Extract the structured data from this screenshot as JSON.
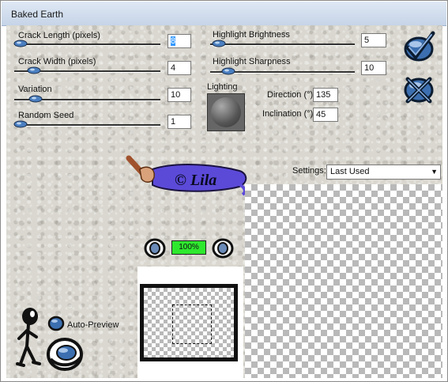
{
  "window": {
    "title": "Baked Earth"
  },
  "params": {
    "crack_length": {
      "label": "Crack Length (pixels)",
      "value": "8",
      "position": 0.0
    },
    "crack_width": {
      "label": "Crack Width (pixels)",
      "value": "4",
      "position": 0.1
    },
    "variation": {
      "label": "Variation",
      "value": "10",
      "position": 0.12
    },
    "random_seed": {
      "label": "Random Seed",
      "value": "1",
      "position": 0.0
    },
    "highlight_brightness": {
      "label": "Highlight Brightness",
      "value": "5",
      "position": 0.02
    },
    "highlight_sharpness": {
      "label": "Highlight Sharpness",
      "value": "10",
      "position": 0.05
    }
  },
  "lighting": {
    "label": "Lighting",
    "direction_label": "Direction (°)",
    "direction": "135",
    "inclination_label": "Inclination (°)",
    "inclination": "45"
  },
  "logo": {
    "text": "© Lila"
  },
  "settings": {
    "label": "Settings:",
    "value": "Last Used"
  },
  "preview": {
    "zoom": "100%",
    "auto_preview_label": "Auto-Preview"
  },
  "icons": {
    "ok": "checkmark-icon",
    "cancel": "cancel-x-icon",
    "zoom_out": "zoom-out-icon",
    "zoom_in": "zoom-in-icon"
  }
}
